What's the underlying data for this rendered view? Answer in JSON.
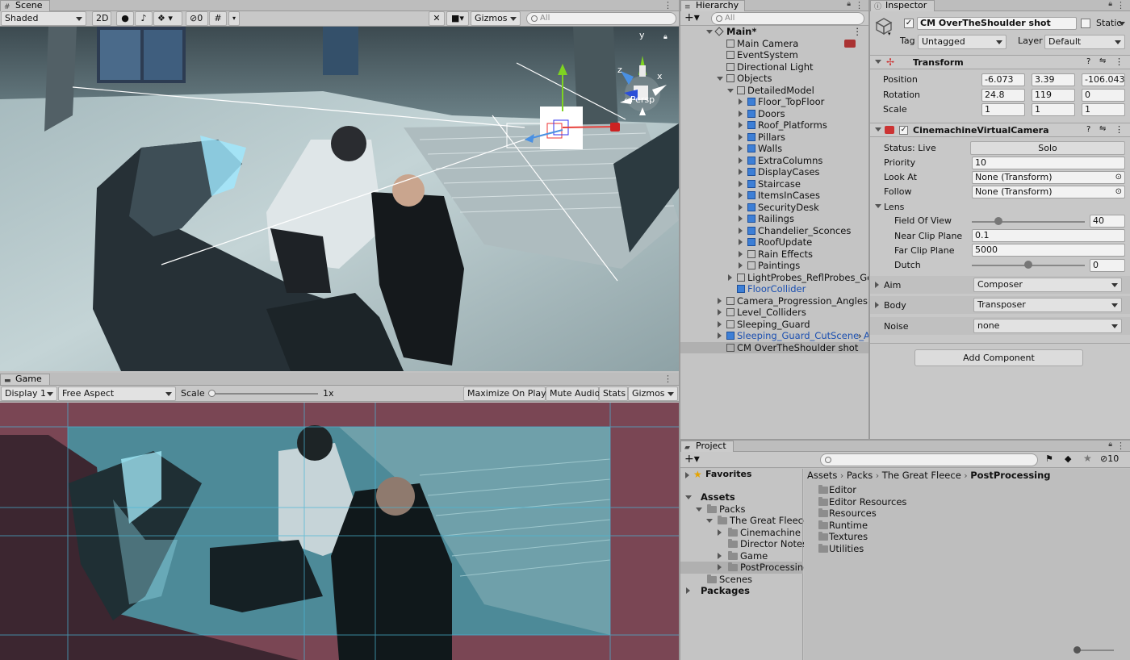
{
  "scene": {
    "tab": "Scene",
    "shading": "Shaded",
    "btn_2d": "2D",
    "hidden_count": "0",
    "gizmos": "Gizmos",
    "search_placeholder": "All",
    "persp": "Persp",
    "axis_y": "y",
    "axis_z": "z",
    "axis_x": "x"
  },
  "game": {
    "tab": "Game",
    "display": "Display 1",
    "aspect": "Free Aspect",
    "scale_label": "Scale",
    "scale_value": "1x",
    "maximize": "Maximize On Play",
    "mute": "Mute Audio",
    "stats": "Stats",
    "gizmos": "Gizmos"
  },
  "hierarchy": {
    "tab": "Hierarchy",
    "search_placeholder": "All",
    "items": [
      {
        "label": "Main*",
        "indent": 0,
        "arrow": "down",
        "icon": "unity-scene-icon",
        "bold": true
      },
      {
        "label": "Main Camera",
        "indent": 1,
        "arrow": "none",
        "icon": "cube-icon"
      },
      {
        "label": "EventSystem",
        "indent": 1,
        "arrow": "none",
        "icon": "cube-icon"
      },
      {
        "label": "Directional Light",
        "indent": 1,
        "arrow": "none",
        "icon": "cube-icon"
      },
      {
        "label": "Objects",
        "indent": 1,
        "arrow": "down",
        "icon": "cube-icon"
      },
      {
        "label": "DetailedModel",
        "indent": 2,
        "arrow": "down",
        "icon": "cube-icon"
      },
      {
        "label": "Floor_TopFloor",
        "indent": 3,
        "arrow": "right",
        "icon": "prefab-icon"
      },
      {
        "label": "Doors",
        "indent": 3,
        "arrow": "right",
        "icon": "prefab-icon"
      },
      {
        "label": "Roof_Platforms",
        "indent": 3,
        "arrow": "right",
        "icon": "prefab-icon"
      },
      {
        "label": "Pillars",
        "indent": 3,
        "arrow": "right",
        "icon": "prefab-icon"
      },
      {
        "label": "Walls",
        "indent": 3,
        "arrow": "right",
        "icon": "prefab-icon"
      },
      {
        "label": "ExtraColumns",
        "indent": 3,
        "arrow": "right",
        "icon": "prefab-icon"
      },
      {
        "label": "DisplayCases",
        "indent": 3,
        "arrow": "right",
        "icon": "prefab-icon"
      },
      {
        "label": "Staircase",
        "indent": 3,
        "arrow": "right",
        "icon": "prefab-icon"
      },
      {
        "label": "ItemsInCases",
        "indent": 3,
        "arrow": "right",
        "icon": "prefab-icon"
      },
      {
        "label": "SecurityDesk",
        "indent": 3,
        "arrow": "right",
        "icon": "prefab-icon"
      },
      {
        "label": "Railings",
        "indent": 3,
        "arrow": "right",
        "icon": "prefab-icon"
      },
      {
        "label": "Chandelier_Sconces",
        "indent": 3,
        "arrow": "right",
        "icon": "prefab-icon"
      },
      {
        "label": "RoofUpdate",
        "indent": 3,
        "arrow": "right",
        "icon": "prefab-icon"
      },
      {
        "label": "Rain Effects",
        "indent": 3,
        "arrow": "right",
        "icon": "cube-icon"
      },
      {
        "label": "Paintings",
        "indent": 3,
        "arrow": "right",
        "icon": "cube-icon"
      },
      {
        "label": "LightProbes_ReflProbes_Godl",
        "indent": 2,
        "arrow": "right",
        "icon": "cube-icon"
      },
      {
        "label": "FloorCollider",
        "indent": 2,
        "arrow": "none",
        "icon": "prefab-icon",
        "blue": true
      },
      {
        "label": "Camera_Progression_Angles",
        "indent": 1,
        "arrow": "right",
        "icon": "cube-icon"
      },
      {
        "label": "Level_Colliders",
        "indent": 1,
        "arrow": "right",
        "icon": "cube-icon"
      },
      {
        "label": "Sleeping_Guard",
        "indent": 1,
        "arrow": "right",
        "icon": "cube-icon"
      },
      {
        "label": "Sleeping_Guard_CutScene_A",
        "indent": 1,
        "arrow": "right",
        "icon": "prefab-icon",
        "blue": true
      },
      {
        "label": "CM OverTheShoulder shot",
        "indent": 1,
        "arrow": "none",
        "icon": "cube-icon",
        "selected": true
      }
    ]
  },
  "inspector": {
    "tab": "Inspector",
    "object_name": "CM OverTheShoulder shot",
    "static_label": "Static",
    "tag_label": "Tag",
    "tag_value": "Untagged",
    "layer_label": "Layer",
    "layer_value": "Default",
    "transform": {
      "title": "Transform",
      "position_label": "Position",
      "rotation_label": "Rotation",
      "scale_label": "Scale",
      "pos": [
        "-6.073",
        "3.39",
        "-106.043"
      ],
      "rot": [
        "24.8",
        "119",
        "0"
      ],
      "scl": [
        "1",
        "1",
        "1"
      ],
      "x": "X",
      "y": "Y",
      "z": "Z"
    },
    "vcam": {
      "title": "CinemachineVirtualCamera",
      "status_label": "Status: Live",
      "solo": "Solo",
      "priority_label": "Priority",
      "priority": "10",
      "lookat_label": "Look At",
      "lookat": "None (Transform)",
      "follow_label": "Follow",
      "follow": "None (Transform)",
      "lens_label": "Lens",
      "fov_label": "Field Of View",
      "fov": "40",
      "near_label": "Near Clip Plane",
      "near": "0.1",
      "far_label": "Far Clip Plane",
      "far": "5000",
      "dutch_label": "Dutch",
      "dutch": "0",
      "aim_label": "Aim",
      "aim": "Composer",
      "body_label": "Body",
      "body": "Transposer",
      "noise_label": "Noise",
      "noise": "none"
    },
    "add_component": "Add Component"
  },
  "project": {
    "tab": "Project",
    "hidden_count": "10",
    "favorites": "Favorites",
    "tree": [
      {
        "label": "Assets",
        "indent": 0,
        "arrow": "down",
        "bold": true
      },
      {
        "label": "Packs",
        "indent": 1,
        "arrow": "down"
      },
      {
        "label": "The Great Fleece",
        "indent": 2,
        "arrow": "down"
      },
      {
        "label": "Cinemachine",
        "indent": 3,
        "arrow": "right"
      },
      {
        "label": "Director Notes",
        "indent": 3,
        "arrow": "none"
      },
      {
        "label": "Game",
        "indent": 3,
        "arrow": "right"
      },
      {
        "label": "PostProcessing",
        "indent": 3,
        "arrow": "right",
        "selected": true
      },
      {
        "label": "Scenes",
        "indent": 1,
        "arrow": "none"
      },
      {
        "label": "Packages",
        "indent": 0,
        "arrow": "right",
        "bold": true
      }
    ],
    "breadcrumb": [
      "Assets",
      "Packs",
      "The Great Fleece",
      "PostProcessing"
    ],
    "folders": [
      "Editor",
      "Editor Resources",
      "Resources",
      "Runtime",
      "Textures",
      "Utilities"
    ]
  }
}
